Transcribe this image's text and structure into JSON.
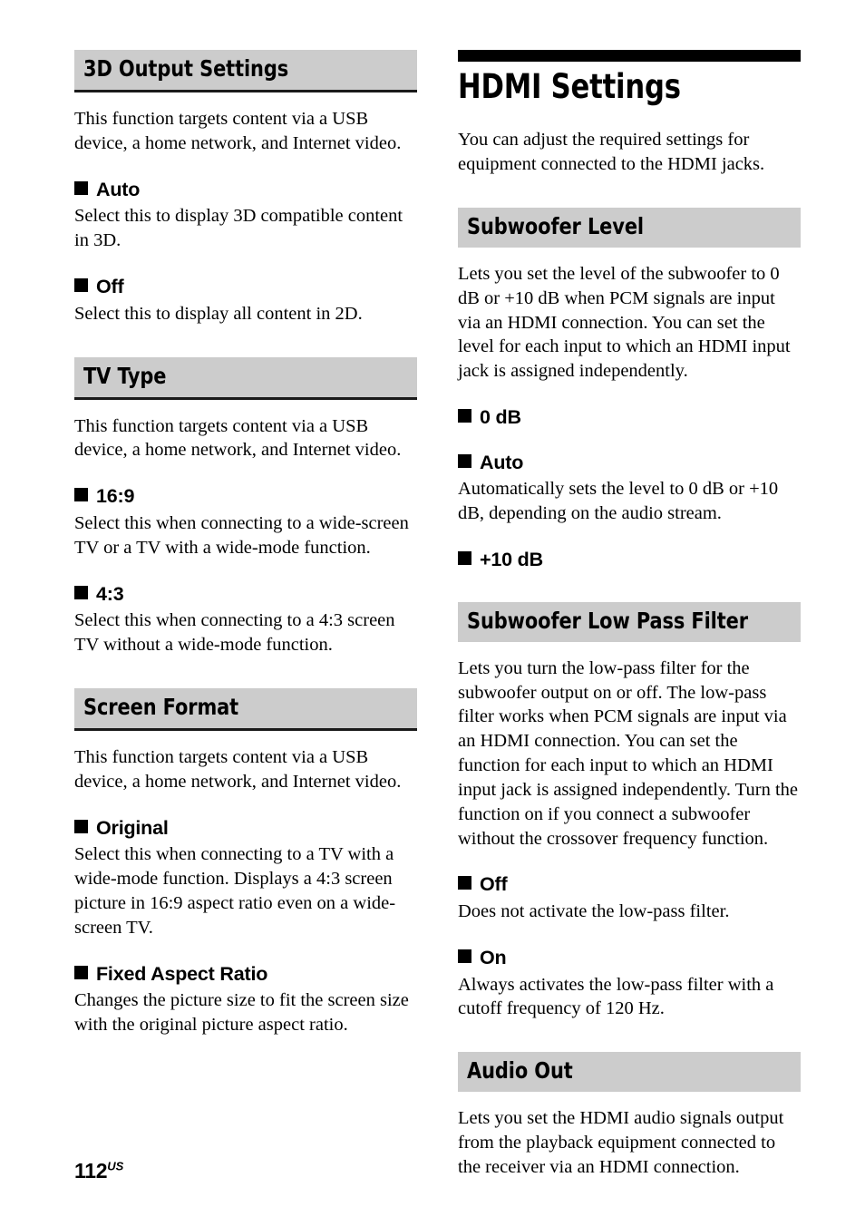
{
  "page": {
    "folio_number": "112",
    "folio_suffix": "US"
  },
  "left_column": {
    "sections": [
      {
        "heading": "3D Output Settings",
        "intro": "This function targets content via a USB device, a home network, and Internet video.",
        "options": [
          {
            "label": "Auto",
            "text": "Select this to display 3D compatible content in 3D."
          },
          {
            "label": "Off",
            "text": "Select this to display all content in 2D."
          }
        ]
      },
      {
        "heading": "TV Type",
        "intro": "This function targets content via a USB device, a home network, and Internet video.",
        "options": [
          {
            "label": "16:9",
            "text": "Select this when connecting to a wide-screen TV or a TV with a wide-mode function."
          },
          {
            "label": "4:3",
            "text": "Select this when connecting to a 4:3 screen TV without a wide-mode function."
          }
        ]
      },
      {
        "heading": "Screen Format",
        "intro": "This function targets content via a USB device, a home network, and Internet video.",
        "options": [
          {
            "label": "Original",
            "text": "Select this when connecting to a TV with a wide-mode function. Displays a 4:3 screen picture in 16:9 aspect ratio even on a wide-screen TV."
          },
          {
            "label": "Fixed Aspect Ratio",
            "text": "Changes the picture size to fit the screen size with the original picture aspect ratio."
          }
        ]
      }
    ]
  },
  "right_column": {
    "chapter_title": "HDMI Settings",
    "chapter_intro": "You can adjust the required settings for equipment connected to the HDMI jacks.",
    "sections": [
      {
        "heading": "Subwoofer Level",
        "intro": "Lets you set the level of the subwoofer to 0 dB or +10 dB when PCM signals are input via an HDMI connection. You can set the level for each input to which an HDMI input jack is assigned independently.",
        "options": [
          {
            "label": "0 dB",
            "text": ""
          },
          {
            "label": "Auto",
            "text": "Automatically sets the level to 0 dB or +10 dB, depending on the audio stream."
          },
          {
            "label": "+10 dB",
            "text": ""
          }
        ]
      },
      {
        "heading": "Subwoofer Low Pass Filter",
        "intro": "Lets you turn the low-pass filter for the subwoofer output on or off. The low-pass filter works when PCM signals are input via an HDMI connection. You can set the function for each input to which an HDMI input jack is assigned independently. Turn the function on if you connect a subwoofer without the crossover frequency function.",
        "options": [
          {
            "label": "Off",
            "text": "Does not activate the low-pass filter."
          },
          {
            "label": "On",
            "text": "Always activates the low-pass filter with a cutoff frequency of 120 Hz."
          }
        ]
      },
      {
        "heading": "Audio Out",
        "intro": "Lets you set the HDMI audio signals output from the playback equipment connected to the receiver via an HDMI connection.",
        "options": []
      }
    ]
  }
}
